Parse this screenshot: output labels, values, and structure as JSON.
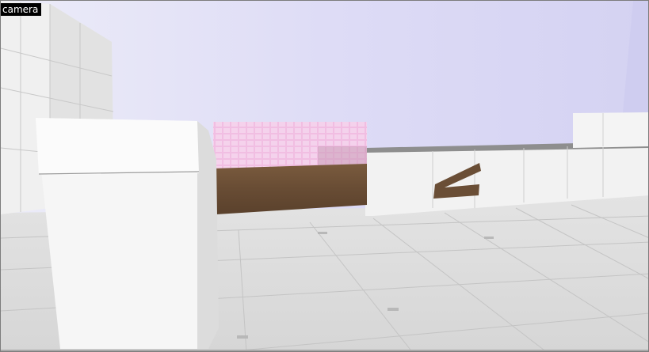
{
  "viewport": {
    "title": "camera"
  },
  "colors": {
    "sky": "#ddddf6",
    "floor": "#dcdcdc",
    "wall": "#e8e8e8",
    "block_front": "#f4f4f4",
    "pink_glass": "#f2b6dd",
    "wood": "#6a4e36",
    "frame_border": "#7c7c7c",
    "label_bg": "#000000",
    "label_text": "#ffffff"
  }
}
